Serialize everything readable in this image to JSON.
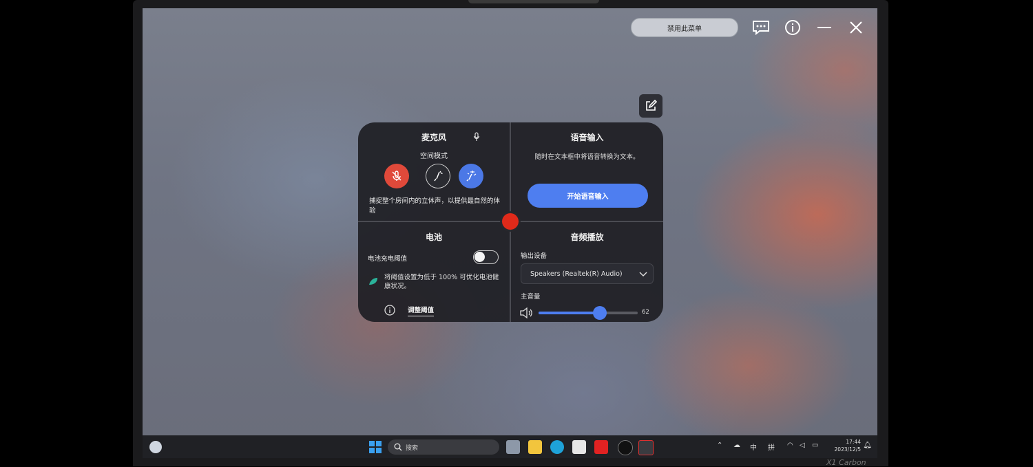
{
  "topbar": {
    "disable_menu_label": "禁用此菜单",
    "icons": [
      "feedback-icon",
      "info-icon",
      "minimize-icon",
      "close-icon"
    ]
  },
  "edit_button": {
    "icon": "edit-icon"
  },
  "microphone": {
    "title": "麦克风",
    "mode_label": "空间模式",
    "modes": [
      {
        "icon": "mic-mute-icon",
        "color": "#e0493a"
      },
      {
        "icon": "focus-voice-icon",
        "color": "#2a2b31"
      },
      {
        "icon": "space-mode-icon",
        "color": "#4b78e6"
      }
    ],
    "description": "捕捉整个房间内的立体声，以提供最自然的体验"
  },
  "voice_input": {
    "title": "语音输入",
    "description": "随时在文本框中将语音转换为文本。",
    "button_label": "开始语音输入"
  },
  "battery": {
    "title": "电池",
    "threshold_label": "电池充电阈值",
    "toggle_on": false,
    "note": "将阈值设置为低于 100% 可优化电池健康状况。",
    "adjust_label": "调整阈值"
  },
  "audio": {
    "title": "音频播放",
    "output_label": "输出设备",
    "output_device": "Speakers (Realtek(R) Audio)",
    "volume_label": "主音量",
    "volume": 62,
    "volume_display": "62",
    "accent": "#4e7ef0"
  },
  "taskbar": {
    "search_placeholder": "搜索",
    "tray_lang": "中",
    "tray_ime": "拼",
    "time": "17:44",
    "date": "2023/12/5"
  },
  "brand": "X1 Carbon"
}
